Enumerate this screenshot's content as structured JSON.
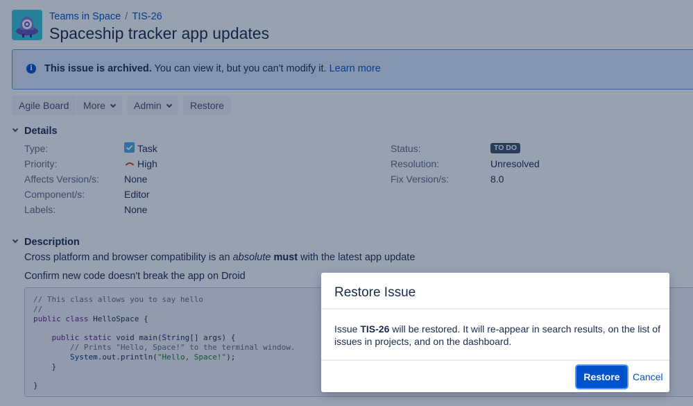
{
  "breadcrumb": {
    "project": "Teams in Space",
    "separator": "/",
    "issue_key": "TIS-26"
  },
  "issue": {
    "title": "Spaceship tracker app updates"
  },
  "banner": {
    "strong": "This issue is archived.",
    "text": " You can view it, but you can't modify it. ",
    "link": "Learn more"
  },
  "toolbar": {
    "agile_board": "Agile Board",
    "more": "More",
    "admin": "Admin",
    "restore": "Restore"
  },
  "details": {
    "title": "Details",
    "left": [
      {
        "label": "Type:",
        "value": "Task"
      },
      {
        "label": "Priority:",
        "value": "High"
      },
      {
        "label": "Affects Version/s:",
        "value": "None"
      },
      {
        "label": "Component/s:",
        "value": "Editor"
      },
      {
        "label": "Labels:",
        "value": "None"
      }
    ],
    "right": [
      {
        "label": "Status:",
        "value": "TO DO"
      },
      {
        "label": "Resolution:",
        "value": "Unresolved"
      },
      {
        "label": "Fix Version/s:",
        "value": "8.0"
      }
    ]
  },
  "description": {
    "title": "Description",
    "p1_a": "Cross platform and browser compatibility is an ",
    "p1_em": "absolute",
    "p1_space": " ",
    "p1_strong": "must",
    "p1_b": " with the latest app update",
    "p2": "Confirm new code doesn't break the app on Droid",
    "code": {
      "l1": "// This class allows you to say hello",
      "l2": "//",
      "l3_kw": "public class",
      "l3_rest": " HelloSpace {",
      "l5_kw": "    public static",
      "l5_void": " void main(",
      "l5_type": "String",
      "l5_rest": "[] args) {",
      "l6": "        // Prints \"Hello, Space!\" to the terminal window.",
      "l7_a": "        ",
      "l7_type": "System",
      "l7_b": ".out.println(",
      "l7_str": "\"Hello, Space!\"",
      "l7_c": ");",
      "l8": "    }",
      "l10": "}"
    }
  },
  "dialog": {
    "title": "Restore Issue",
    "body_a": "Issue ",
    "body_key": "TIS-26",
    "body_b": " will be restored. It will re-appear in search results, on the list of issues in projects, and on the dashboard.",
    "confirm": "Restore",
    "cancel": "Cancel"
  },
  "colors": {
    "primary": "#0052cc",
    "overlay": "#091e42",
    "banner_bg": "#deebff",
    "lozenge": "#42526e"
  }
}
